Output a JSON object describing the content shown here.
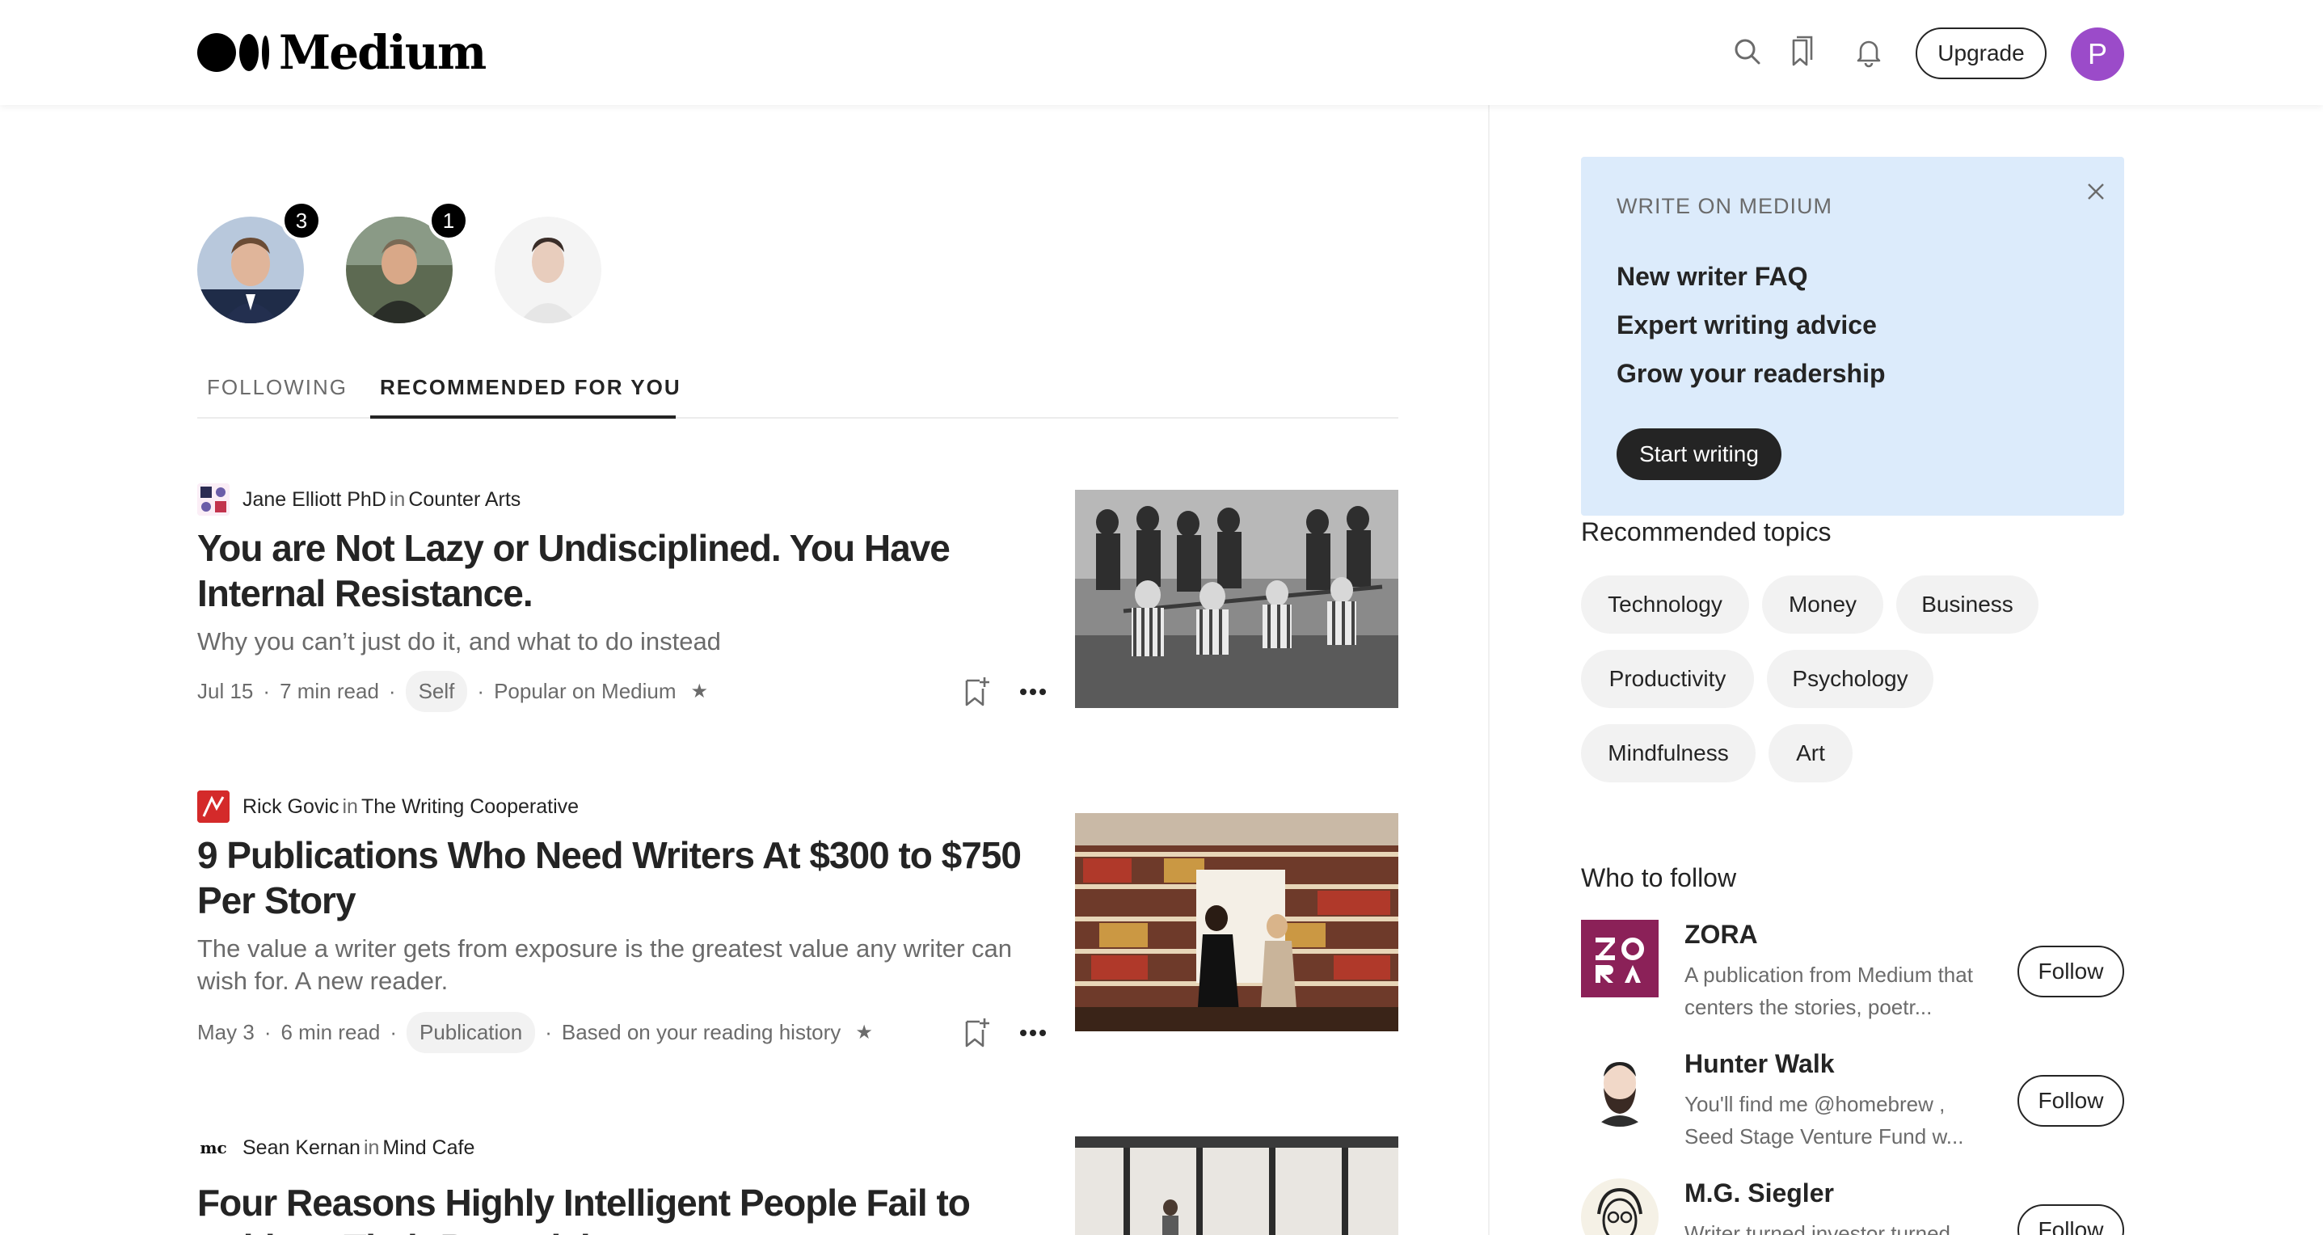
{
  "header": {
    "logo_text": "Medium",
    "upgrade_label": "Upgrade",
    "avatar_initial": "P",
    "avatar_color": "#9b4bc9",
    "icons": [
      "search-icon",
      "bookmarks-icon",
      "bell-icon"
    ]
  },
  "following_avatars": [
    {
      "badge": "3"
    },
    {
      "badge": "1"
    },
    {
      "badge": ""
    }
  ],
  "tabs": [
    {
      "label": "FOLLOWING",
      "active": false
    },
    {
      "label": "RECOMMENDED FOR YOU",
      "active": true
    }
  ],
  "articles": [
    {
      "author": "Jane Elliott PhD",
      "in": "in",
      "publication": "Counter Arts",
      "title": "You are Not Lazy or Undisciplined. You Have Internal Resistance.",
      "subtitle": "Why you can’t just do it, and what to do instead",
      "date": "Jul 15",
      "read_time": "7 min read",
      "tag": "Self",
      "reason": "Popular on Medium",
      "star": "★"
    },
    {
      "author": "Rick Govic",
      "in": "in",
      "publication": "The Writing Cooperative",
      "title": "9 Publications Who Need Writers At $300 to $750 Per Story",
      "subtitle": "The value a writer gets from exposure is the greatest value any writer can wish for. A new reader.",
      "date": "May 3",
      "read_time": "6 min read",
      "tag": "Publication",
      "reason": "Based on your reading history",
      "star": "★"
    },
    {
      "author": "Sean Kernan",
      "in": "in",
      "publication": "Mind Cafe",
      "title": "Four Reasons Highly Intelligent People Fail to Achieve Their Potential",
      "publication_icon_text": "mc"
    }
  ],
  "dot": "·",
  "write_on_medium": {
    "title": "WRITE ON MEDIUM",
    "links": [
      "New writer FAQ",
      "Expert writing advice",
      "Grow your readership"
    ],
    "button": "Start writing"
  },
  "recommended_topics": {
    "title": "Recommended topics",
    "topics": [
      "Technology",
      "Money",
      "Business",
      "Productivity",
      "Psychology",
      "Mindfulness",
      "Art"
    ]
  },
  "who_to_follow": {
    "title": "Who to follow",
    "follow_label": "Follow",
    "items": [
      {
        "name": "ZORA",
        "desc": "A publication from Medium that centers the stories, poetr...",
        "logo_text": "ZO RA"
      },
      {
        "name": "Hunter Walk",
        "desc": "You'll find me @homebrew , Seed Stage Venture Fund w..."
      },
      {
        "name": "M.G. Siegler",
        "desc": "Writer turned investor turned..."
      }
    ]
  },
  "colors": {
    "text": "#242424",
    "muted": "#6b6b6b",
    "write_box_bg": "#dcebfb",
    "chip_bg": "#f2f2f2",
    "zora_bg": "#8b2158",
    "rick_icon_bg": "#d42a2a"
  }
}
